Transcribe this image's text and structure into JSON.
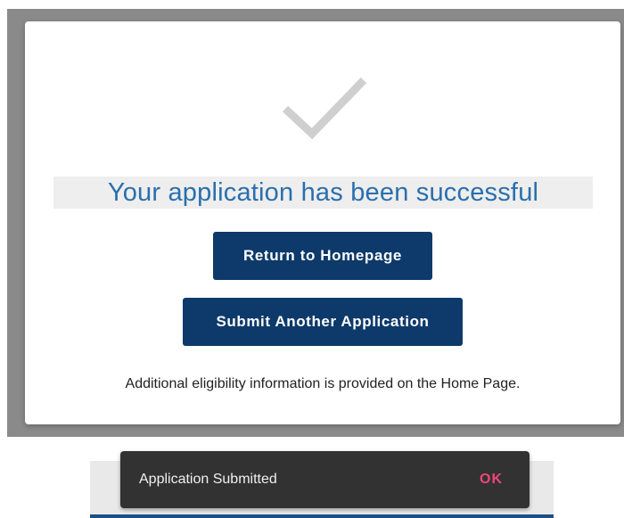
{
  "dialog": {
    "icon": "checkmark-icon",
    "title": "Your application has been successful",
    "return_button_label": "Return to Homepage",
    "another_button_label": "Submit Another Application",
    "info_text": "Additional eligibility information is provided on the Home Page."
  },
  "snackbar": {
    "message": "Application Submitted",
    "action_label": "OK"
  },
  "colors": {
    "title": "#2a6fad",
    "button": "#0d3a6a",
    "snackbar_bg": "#323232",
    "snackbar_action": "#f0457a",
    "check_icon": "#cfcfcf"
  }
}
